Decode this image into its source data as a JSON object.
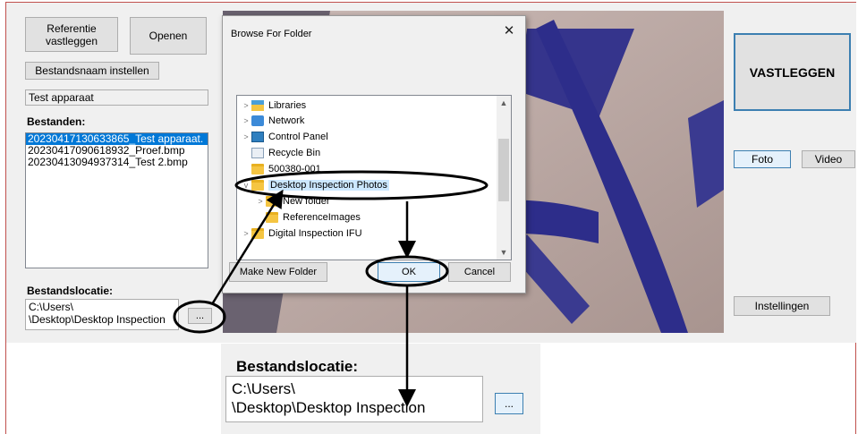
{
  "app": {
    "referentie_button": "Referentie\nvastleggen",
    "openen_button": "Openen",
    "bestandsnaam_button": "Bestandsnaam instellen",
    "name_field_value": "Test apparaat",
    "bestanden_label": "Bestanden:",
    "files": [
      "20230417130633865_Test apparaat.",
      "20230417090618932_Proef.bmp",
      "20230413094937314_Test 2.bmp"
    ],
    "selected_file_index": 0,
    "bestandslocatie_label": "Bestandslocatie:",
    "location_value": "C:\\Users\\\n\\Desktop\\Desktop Inspection",
    "browse_button": "...",
    "vastleggen_button": "VASTLEGGEN",
    "foto_button": "Foto",
    "video_button": "Video",
    "instellingen_button": "Instellingen"
  },
  "dialog": {
    "title": "Browse For Folder",
    "close_icon": "close-icon",
    "tree": [
      {
        "label": "Libraries",
        "icon": "libraries-icon",
        "expander": ">",
        "level": 0
      },
      {
        "label": "Network",
        "icon": "network-icon",
        "expander": ">",
        "level": 0
      },
      {
        "label": "Control Panel",
        "icon": "control-panel-icon",
        "expander": ">",
        "level": 0
      },
      {
        "label": "Recycle Bin",
        "icon": "recycle-bin-icon",
        "expander": "",
        "level": 0
      },
      {
        "label": "500380-001",
        "icon": "folder-icon",
        "expander": "",
        "level": 0
      },
      {
        "label": "Desktop Inspection Photos",
        "icon": "folder-icon",
        "expander": "v",
        "level": 0
      },
      {
        "label": "New folder",
        "icon": "folder-icon",
        "expander": ">",
        "level": 1
      },
      {
        "label": "ReferenceImages",
        "icon": "folder-icon",
        "expander": "",
        "level": 1
      },
      {
        "label": "Digital Inspection IFU",
        "icon": "folder-icon",
        "expander": ">",
        "level": 0
      }
    ],
    "selected_index": 5,
    "make_new_folder_button": "Make New Folder",
    "ok_button": "OK",
    "cancel_button": "Cancel"
  },
  "zoom": {
    "label": "Bestandslocatie:",
    "location_value": "C:\\Users\\\n\\Desktop\\Desktop Inspection",
    "browse_button": "..."
  },
  "colors": {
    "annotation": "#000000",
    "frame_border": "#c0504d",
    "selection": "#0078d7",
    "tree_highlight": "#cce8ff"
  }
}
